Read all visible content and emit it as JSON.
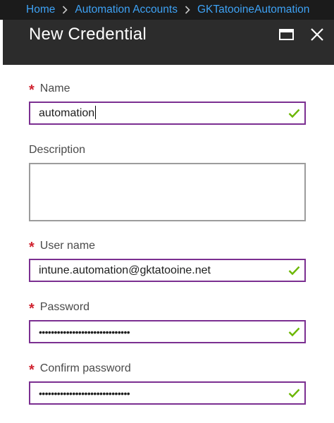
{
  "breadcrumb": {
    "items": [
      "Home",
      "Automation Accounts",
      "GKTatooineAutomation"
    ]
  },
  "blade": {
    "title": "New Credential"
  },
  "form": {
    "name": {
      "label": "Name",
      "value": "automation",
      "required": true
    },
    "description": {
      "label": "Description",
      "value": ""
    },
    "username": {
      "label": "User name",
      "value": "intune.automation@gktatooine.net",
      "required": true
    },
    "password": {
      "label": "Password",
      "value": "••••••••••••••••••••••••••••••",
      "required": true
    },
    "confirm_password": {
      "label": "Confirm password",
      "value": "••••••••••••••••••••••••••••••",
      "required": true
    }
  },
  "colors": {
    "breadcrumb_link": "#3ea2f5",
    "header_bg": "#2c2c2c",
    "focus_border": "#7b2f91",
    "required_asterisk": "#d0232f",
    "valid_check": "#6bb700"
  },
  "icons": {
    "header": [
      "maximize-icon",
      "close-icon"
    ],
    "field_status": "checkmark-icon"
  }
}
